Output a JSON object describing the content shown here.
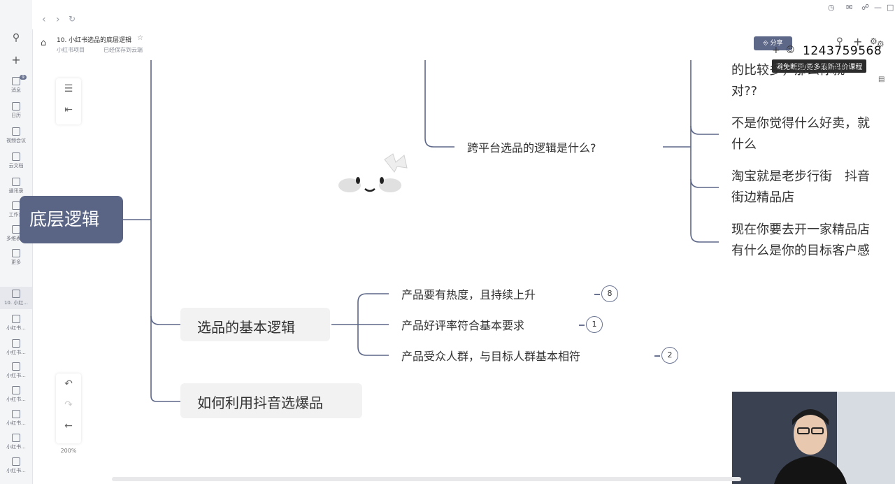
{
  "sidebar": {
    "badge": "9",
    "items": [
      {
        "label": "消息"
      },
      {
        "label": "日历"
      },
      {
        "label": "视频会议"
      },
      {
        "label": "云文档"
      },
      {
        "label": "通讯录"
      },
      {
        "label": "工作台"
      },
      {
        "label": "多维表格"
      },
      {
        "label": "更多"
      },
      {
        "label": "10. 小红..."
      },
      {
        "label": "小红书..."
      },
      {
        "label": "小红书..."
      },
      {
        "label": "小红书..."
      },
      {
        "label": "小红书..."
      },
      {
        "label": "小红书..."
      },
      {
        "label": "小红书..."
      },
      {
        "label": "小红书..."
      }
    ]
  },
  "header": {
    "title": "10. 小红书选品的底层逻辑",
    "breadcrumb": "小红书项目",
    "save_status": "已经保存到云端",
    "share_label": "分享"
  },
  "watermark": {
    "number": "1243759568",
    "banner": "避免断更/更多最新低价课程"
  },
  "toolbar": {
    "zoom": "200%"
  },
  "mindmap": {
    "root": "底层逻辑",
    "branches": {
      "cross_platform": "跨平台选品的逻辑是什么?",
      "basic": "选品的基本逻辑",
      "douyin": "如何利用抖音选爆品"
    },
    "basic_children": [
      {
        "text": "产品要有热度，且持续上升",
        "count": "8"
      },
      {
        "text": "产品好评率符合基本要求",
        "count": "1"
      },
      {
        "text": "产品受众人群，与目标人群基本相符",
        "count": "2"
      }
    ],
    "cross_children": [
      {
        "line1": "的比较多，那么你就",
        "line2": "对??"
      },
      {
        "line1": "不是你觉得什么好卖，就",
        "line2": "什么"
      },
      {
        "line1": "淘宝就是老步行街　抖音",
        "line2": "街边精品店"
      },
      {
        "line1": "现在你要去开一家精品店",
        "line2": "有什么是你的目标客户感"
      }
    ]
  }
}
